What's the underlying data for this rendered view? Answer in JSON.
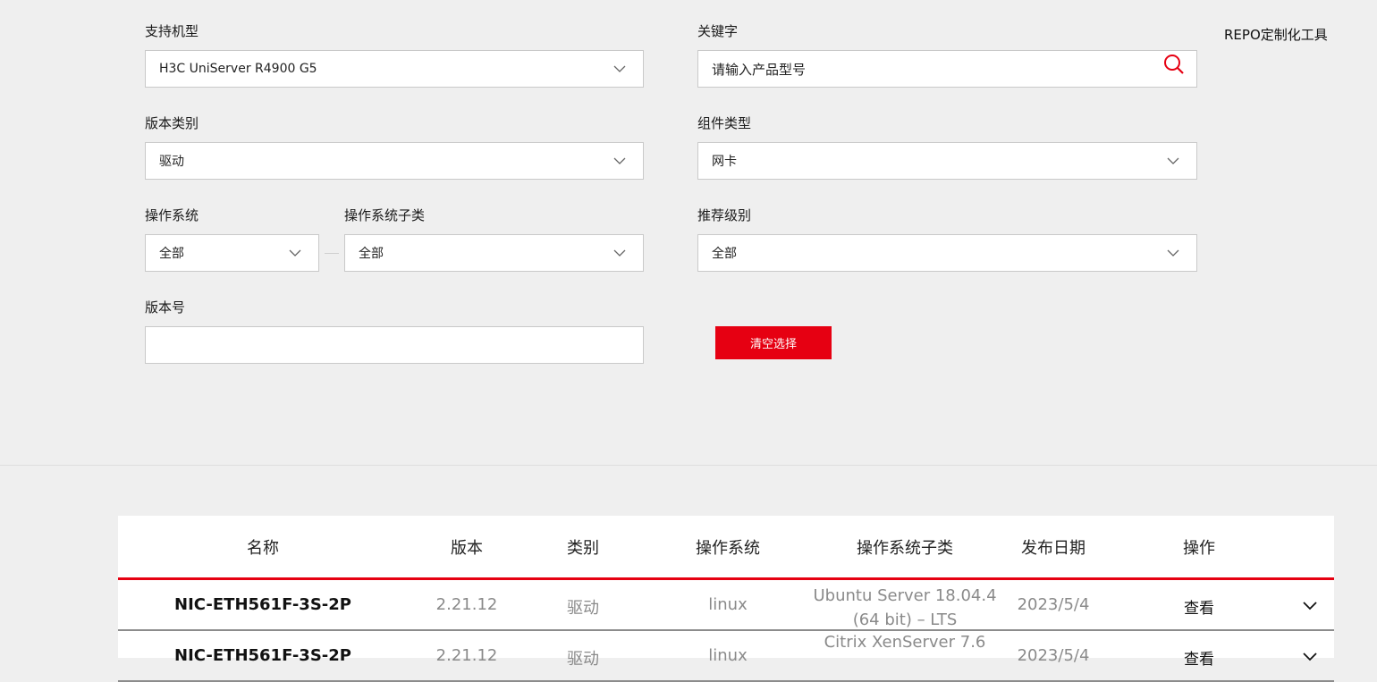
{
  "filters": {
    "model": {
      "label": "支持机型",
      "value": "H3C UniServer R4900 G5"
    },
    "keyword": {
      "label": "关键字",
      "placeholder": "请输入产品型号"
    },
    "version_type": {
      "label": "版本类别",
      "value": "驱动"
    },
    "component_type": {
      "label": "组件类型",
      "value": "网卡"
    },
    "os": {
      "label": "操作系统",
      "value": "全部"
    },
    "os_sub": {
      "label": "操作系统子类",
      "value": "全部"
    },
    "level": {
      "label": "推荐级别",
      "value": "全部"
    },
    "version_no": {
      "label": "版本号",
      "value": ""
    },
    "clear_label": "清空选择"
  },
  "repo_link": "REPO定制化工具",
  "table": {
    "headers": [
      "名称",
      "版本",
      "类别",
      "操作系统",
      "操作系统子类",
      "发布日期",
      "操作"
    ],
    "rows": [
      {
        "name": "NIC-ETH561F-3S-2P",
        "version": "2.21.12",
        "category": "驱动",
        "os": "linux",
        "os_sub_line1": "Ubuntu Server 18.04.4",
        "os_sub_line2": "(64 bit) – LTS",
        "date": "2023/5/4",
        "action": "查看"
      },
      {
        "name": "NIC-ETH561F-3S-2P",
        "version": "2.21.12",
        "category": "驱动",
        "os": "linux",
        "os_sub_line1": "Citrix XenServer 7.6",
        "os_sub_line2": "",
        "date": "2023/5/4",
        "action": "查看"
      }
    ]
  },
  "colors": {
    "accent": "#e60012",
    "background": "#efefef"
  },
  "icons": {
    "dropdown": "chevron-down-icon",
    "search": "search-icon"
  }
}
